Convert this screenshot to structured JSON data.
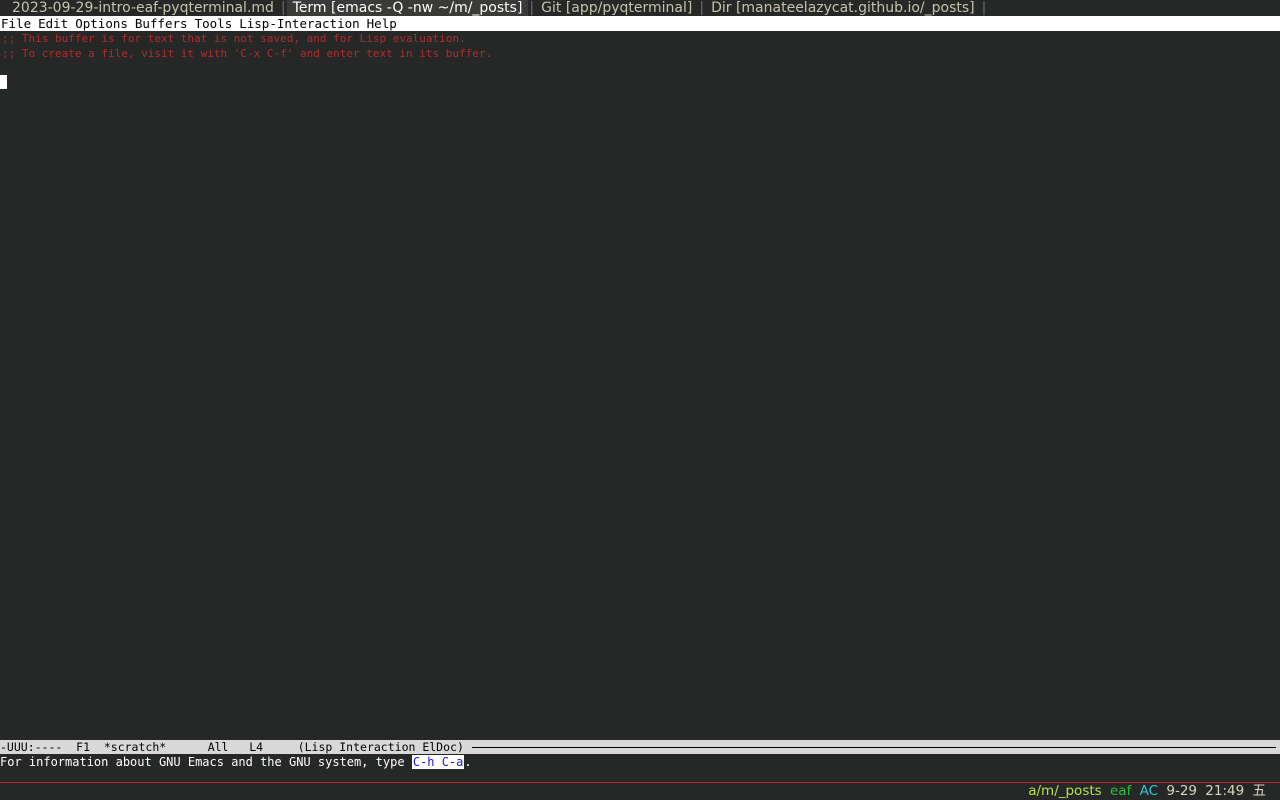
{
  "tabs": [
    {
      "label": "2023-09-29-intro-eaf-pyqterminal.md",
      "active": false
    },
    {
      "label": "Term [emacs -Q -nw ~/m/_posts]",
      "active": true
    },
    {
      "label": "Git [app/pyqterminal]",
      "active": false
    },
    {
      "label": "Dir [manateelazycat.github.io/_posts]",
      "active": false
    }
  ],
  "tab_separator": "|",
  "menu": [
    "File",
    "Edit",
    "Options",
    "Buffers",
    "Tools",
    "Lisp-Interaction",
    "Help"
  ],
  "buffer": {
    "lines": [
      ";; This buffer is for text that is not saved, and for Lisp evaluation.",
      ";; To create a file, visit it with 'C-x C-f' and enter text in its buffer."
    ]
  },
  "modeline": {
    "text": "-UUU:----  F1  *scratch*      All   L4     (Lisp Interaction ElDoc)"
  },
  "echo": {
    "prefix": "For information about GNU Emacs and the GNU system, type ",
    "key": "C-h C-a",
    "suffix": "."
  },
  "status": {
    "path": "a/m/_posts",
    "eaf": "eaf",
    "ac": "AC",
    "date": "9-29",
    "time": "21:49",
    "weekday": "五"
  },
  "colors": {
    "background": "#262727",
    "comment": "#b32b2b",
    "status_path": "#b6e24b",
    "status_eaf": "#2bbf3b",
    "status_ac": "#2fc7d9"
  }
}
